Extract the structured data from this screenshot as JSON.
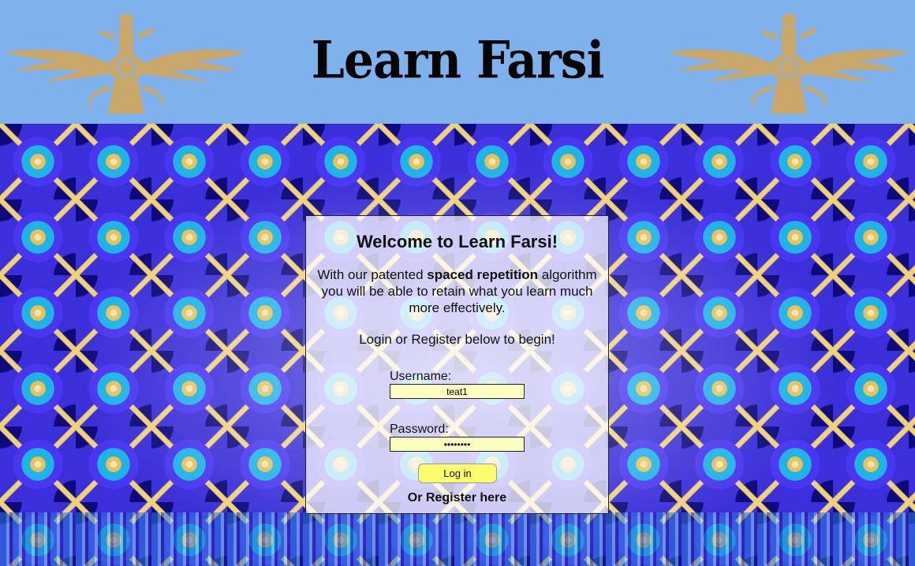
{
  "header": {
    "title": "Learn Farsi",
    "logo_icon": "faravahar-icon",
    "background_color": "#7fb2ec",
    "logo_color": "#c8a768"
  },
  "card": {
    "heading": "Welcome to Learn Farsi!",
    "intro_before": "With our patented ",
    "intro_bold": "spaced repetition",
    "intro_after": " algorithm you will be able to retain what you learn much more effectively.",
    "prompt": "Login or Register below to begin!"
  },
  "form": {
    "username_label": "Username:",
    "username_value": "teat1",
    "password_label": "Password:",
    "password_value": "••••••••",
    "login_button": "Log in",
    "register_link": "Or Register here",
    "input_color": "#fafcc0",
    "button_color": "#fdfb6e"
  }
}
